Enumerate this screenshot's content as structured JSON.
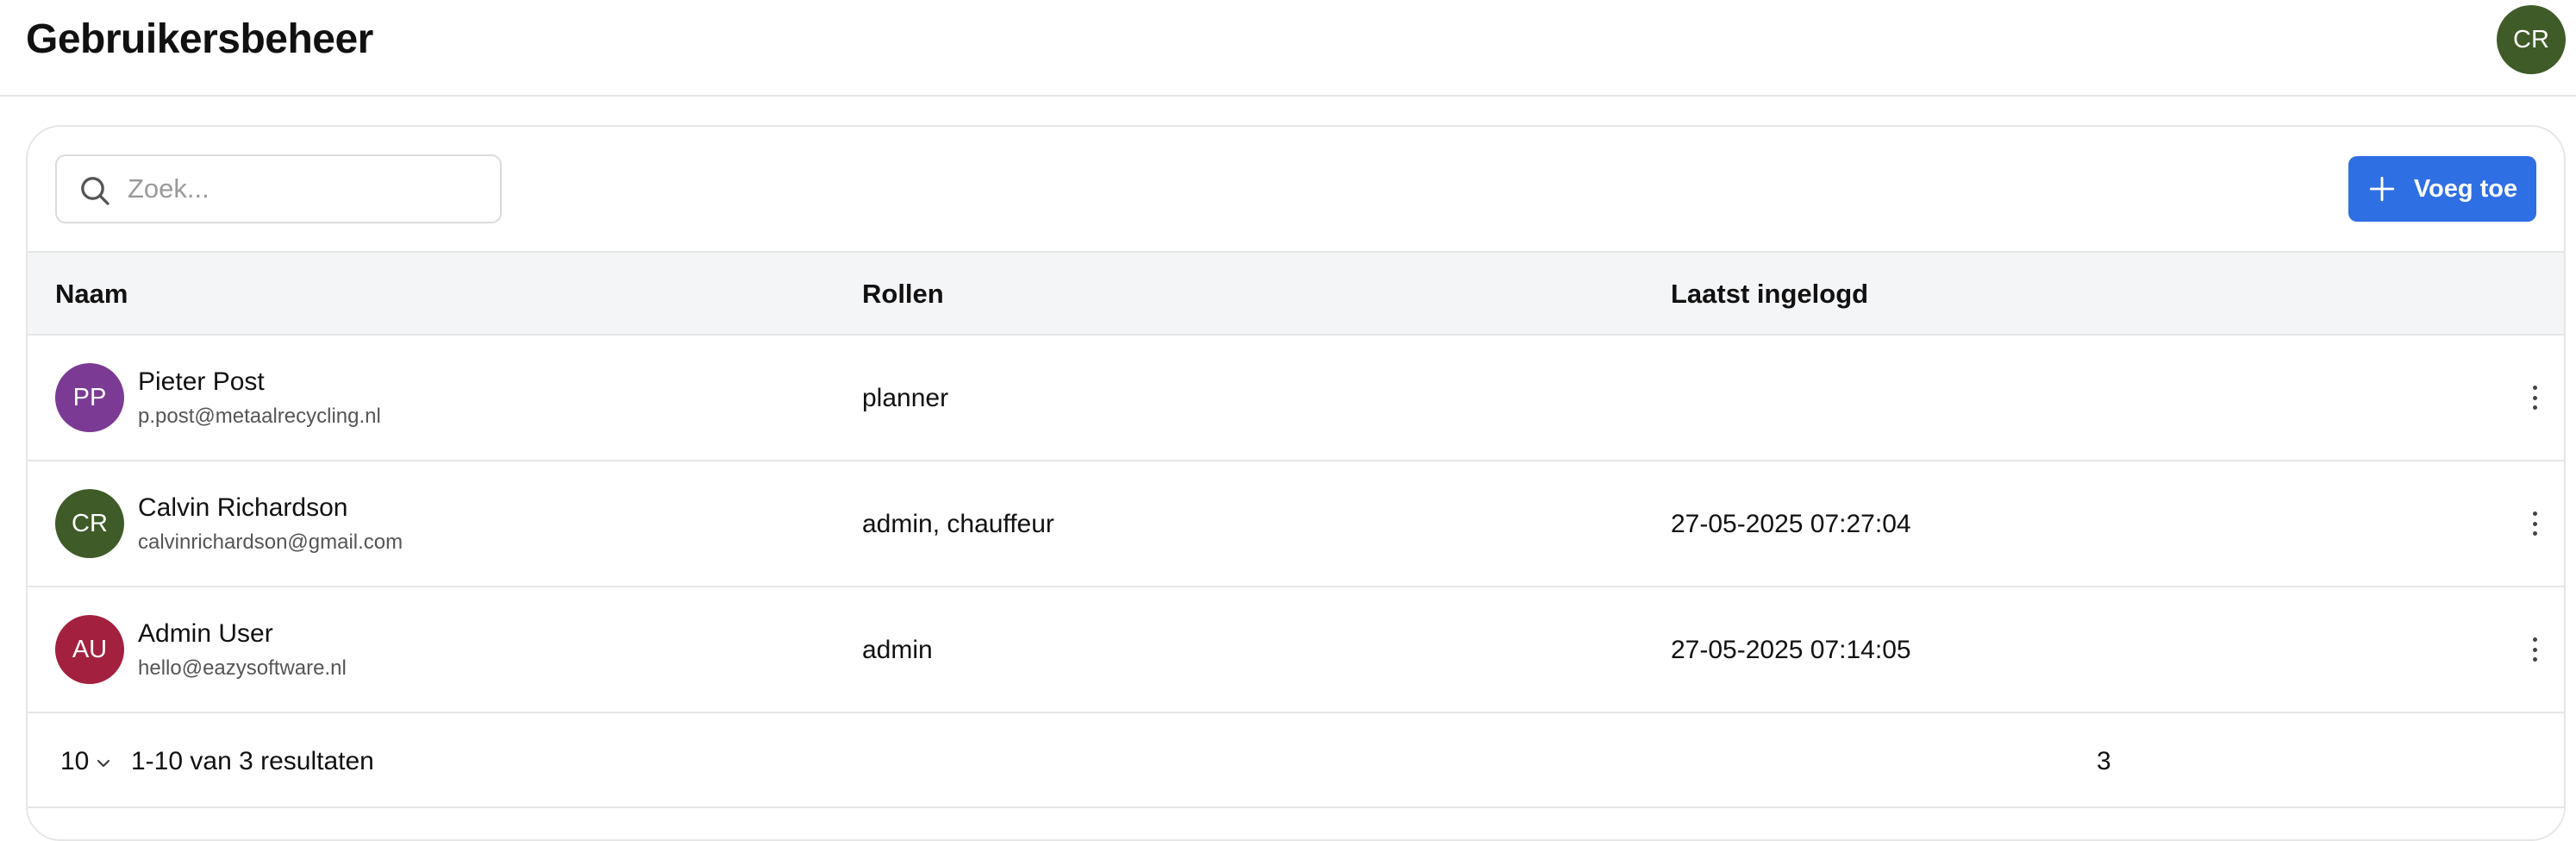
{
  "header": {
    "title": "Gebruikersbeheer",
    "user_initials": "CR",
    "user_avatar_color": "#3f5b28"
  },
  "toolbar": {
    "search_placeholder": "Zoek...",
    "search_value": "",
    "add_label": "Voeg toe",
    "accent_color": "#2f6fe4"
  },
  "table": {
    "columns": [
      "Naam",
      "Rollen",
      "Laatst ingelogd"
    ],
    "rows": [
      {
        "initials": "PP",
        "avatar_color": "#7b3b94",
        "name": "Pieter Post",
        "email": "p.post@metaalrecycling.nl",
        "roles": "planner",
        "last_login": ""
      },
      {
        "initials": "CR",
        "avatar_color": "#3f5b28",
        "name": "Calvin Richardson",
        "email": "calvinrichardson@gmail.com",
        "roles": "admin, chauffeur",
        "last_login": "27-05-2025 07:27:04"
      },
      {
        "initials": "AU",
        "avatar_color": "#a3203f",
        "name": "Admin User",
        "email": "hello@eazysoftware.nl",
        "roles": "admin",
        "last_login": "27-05-2025 07:14:05"
      }
    ]
  },
  "pagination": {
    "per_page": "10",
    "result_text": "1-10 van 3 resultaten",
    "page": "3"
  }
}
